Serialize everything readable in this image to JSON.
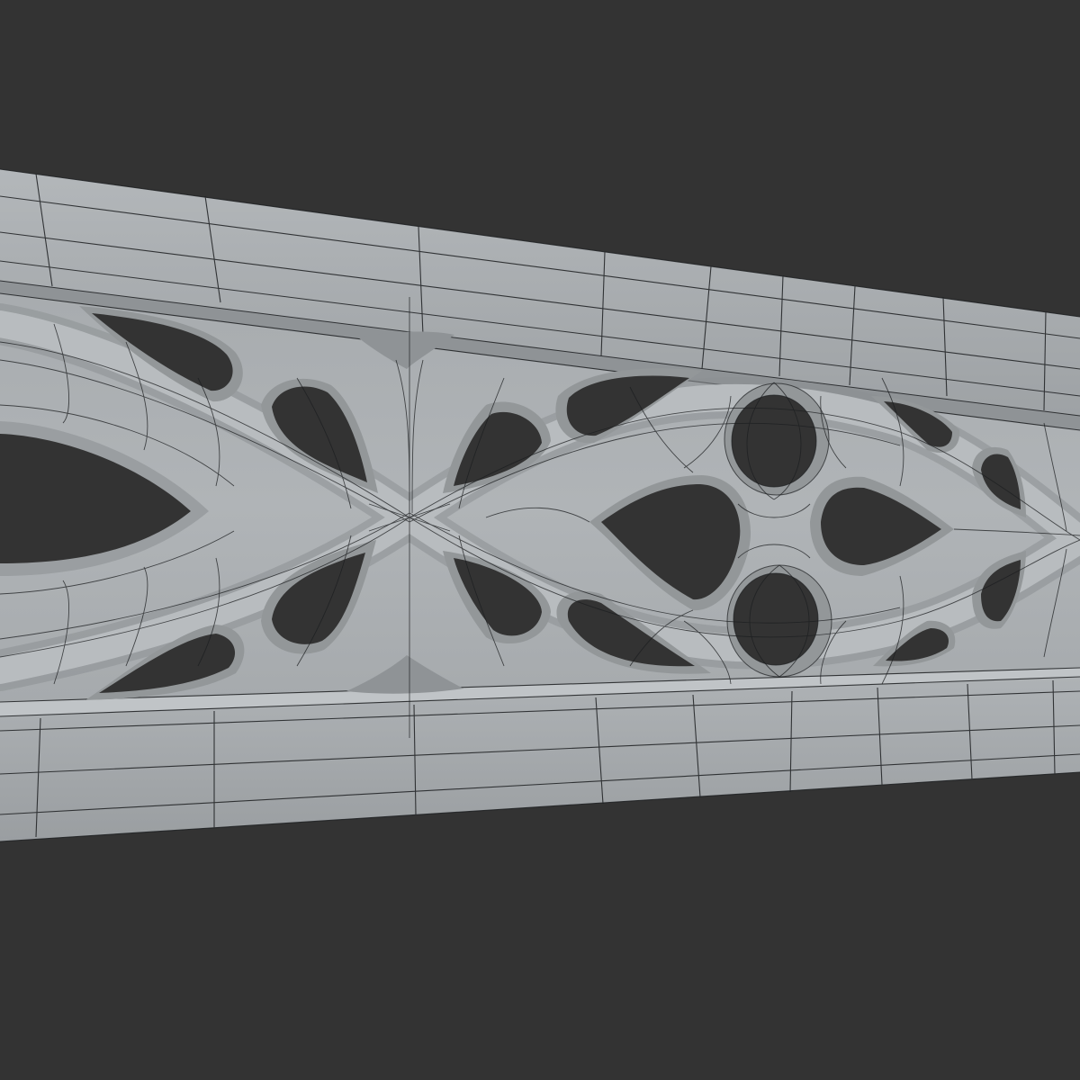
{
  "scene": {
    "subject": "gothic-tracery-frieze",
    "colors": {
      "background": "#333333",
      "surface": "#a7abae",
      "surface_light": "#b9bdc0",
      "surface_shade": "#8e9295",
      "wire": "#1c1e20",
      "hole": "#333333"
    }
  }
}
